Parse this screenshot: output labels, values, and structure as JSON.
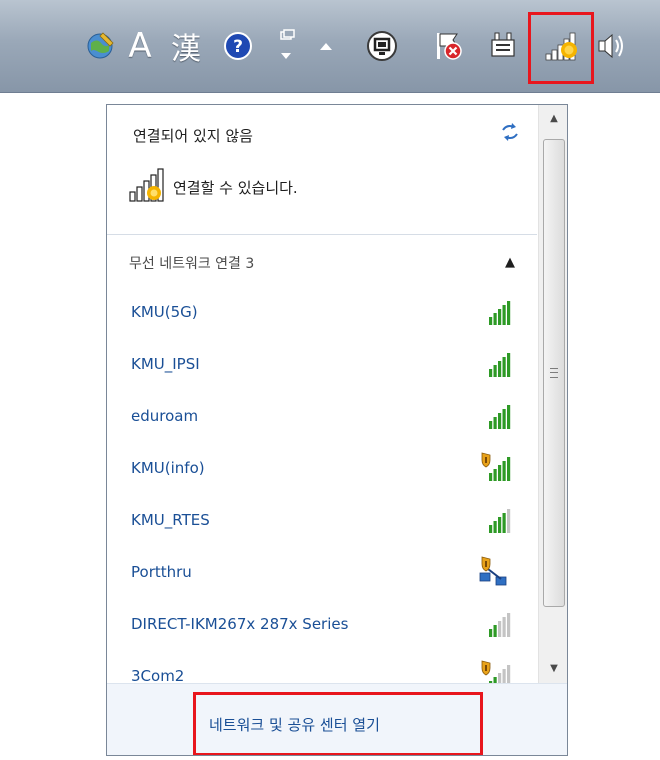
{
  "taskbar": {
    "ime_letter": "A",
    "ime_hanja": "漢",
    "icons": [
      "language-bar-icon",
      "ime-mode-icon",
      "hanja-icon",
      "help-icon",
      "ime-options-icon",
      "show-hidden-icons-icon",
      "display-icon",
      "action-center-icon",
      "power-icon",
      "network-icon",
      "volume-icon"
    ]
  },
  "flyout": {
    "status_title": "연결되어 있지 않음",
    "status_message": "연결할 수 있습니다.",
    "group_header": "무선 네트워크 연결 3",
    "networks": [
      {
        "name": "KMU(5G)",
        "bars": 5,
        "secured": false
      },
      {
        "name": "KMU_IPSI",
        "bars": 5,
        "secured": false
      },
      {
        "name": "eduroam",
        "bars": 5,
        "secured": false
      },
      {
        "name": "KMU(info)",
        "bars": 5,
        "secured": true
      },
      {
        "name": "KMU_RTES",
        "bars": 4,
        "secured": false
      },
      {
        "name": "Portthru",
        "bars": 0,
        "secured": true,
        "type": "adhoc"
      },
      {
        "name": "DIRECT-IKM267x 287x Series",
        "bars": 2,
        "secured": false
      },
      {
        "name": "3Com2",
        "bars": 2,
        "secured": true
      }
    ],
    "footer_link": "네트워크 및 공유 센터 열기"
  },
  "colors": {
    "link": "#1a4f96",
    "highlight": "#e8161d",
    "signal_green": "#2e9a26"
  }
}
